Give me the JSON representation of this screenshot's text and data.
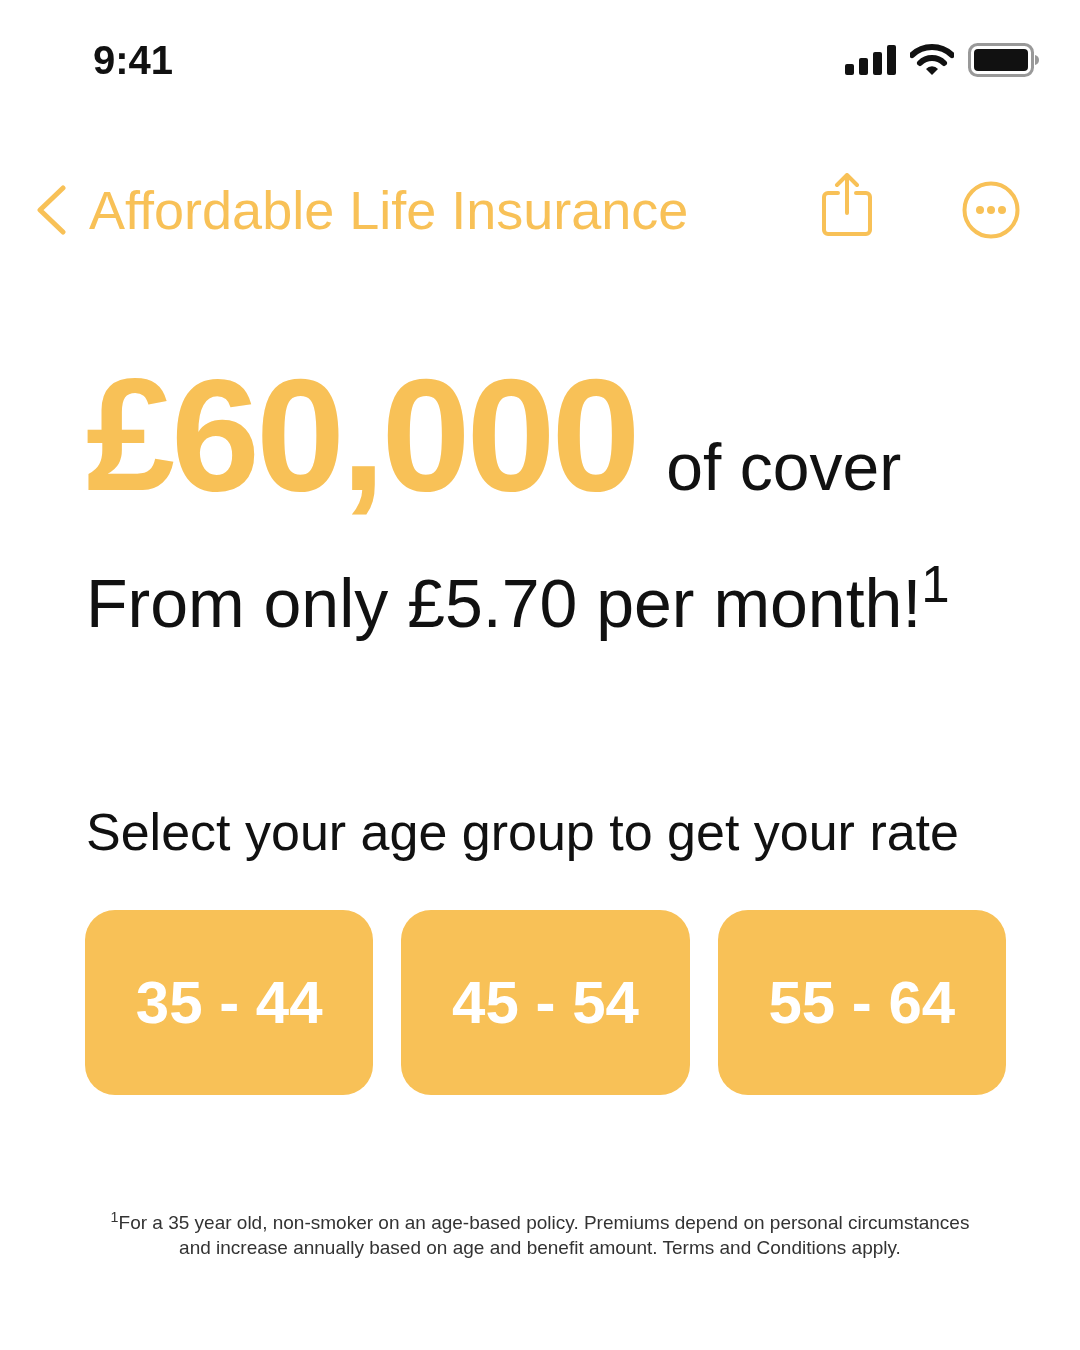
{
  "status_bar": {
    "time": "9:41"
  },
  "nav": {
    "title": "Affordable Life Insurance"
  },
  "hero": {
    "amount": "£60,000",
    "amount_suffix": "of cover",
    "price_line": "From only £5.70 per month!$^{1}$"
  },
  "age_selector": {
    "prompt": "Select your age group to get your rate",
    "options": [
      {
        "label": "35 - 44"
      },
      {
        "label": "45 - 54"
      },
      {
        "label": "55 - 64"
      }
    ]
  },
  "footnote": "$^{1}$For a 35 year old, non-smoker on an age-based policy. Premiums depend on personal circumstances and increase annually based on age and benefit amount. Terms and Conditions apply."
}
